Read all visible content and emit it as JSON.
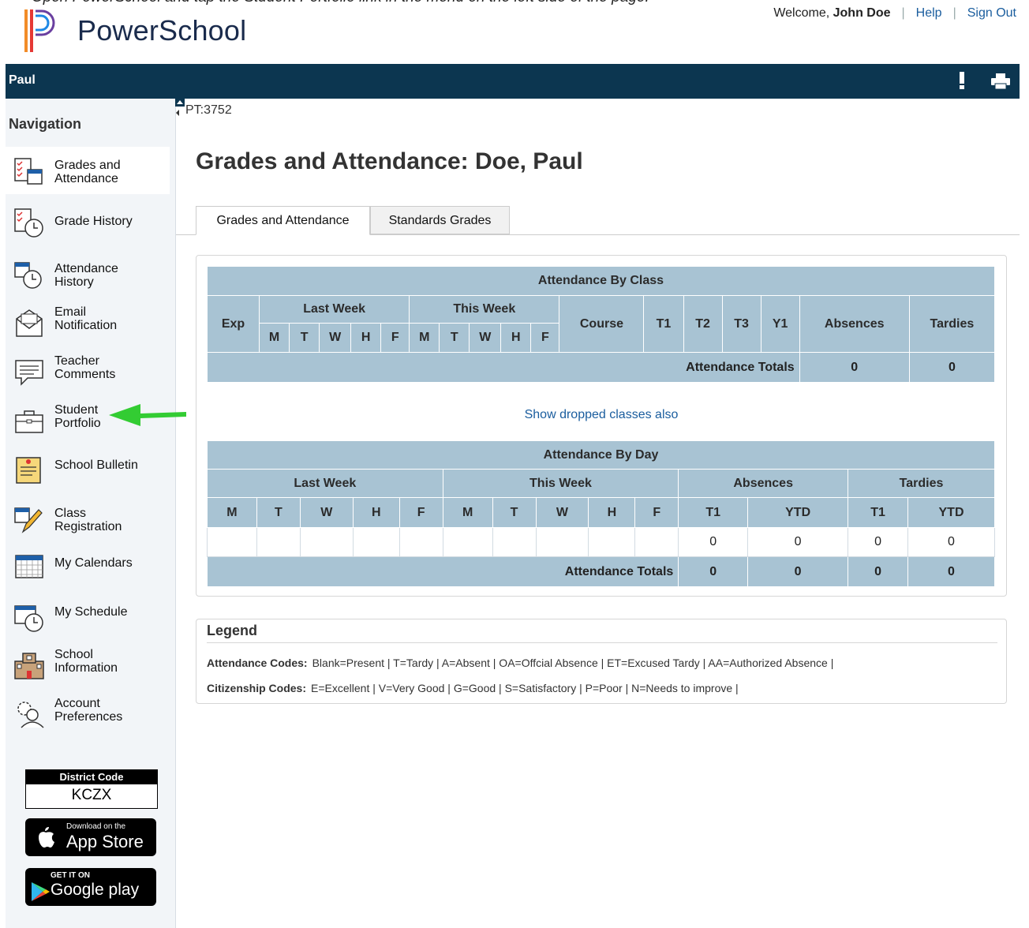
{
  "header": {
    "cutoff_text": "Open PowerSchool and tap the Student Portfolio link in the menu on the left side of the page.",
    "app_name": "PowerSchool",
    "welcome_label": "Welcome,",
    "user_name": "John Doe",
    "help": "Help",
    "sign_out": "Sign Out"
  },
  "bar": {
    "student": "Paul"
  },
  "nav": {
    "title": "Navigation",
    "items": [
      {
        "line1": "Grades and",
        "line2": "Attendance"
      },
      {
        "line1": "Grade History",
        "line2": ""
      },
      {
        "line1": "Attendance",
        "line2": "History"
      },
      {
        "line1": "Email",
        "line2": "Notification"
      },
      {
        "line1": "Teacher",
        "line2": "Comments"
      },
      {
        "line1": "Student",
        "line2": "Portfolio"
      },
      {
        "line1": "School Bulletin",
        "line2": ""
      },
      {
        "line1": "Class",
        "line2": "Registration"
      },
      {
        "line1": "My Calendars",
        "line2": ""
      },
      {
        "line1": "My Schedule",
        "line2": ""
      },
      {
        "line1": "School",
        "line2": "Information"
      },
      {
        "line1": "Account",
        "line2": "Preferences"
      }
    ],
    "district": {
      "label": "District Code",
      "value": "KCZX"
    },
    "appstore": {
      "small": "Download on the",
      "big": "App Store"
    },
    "googleplay": {
      "small": "GET IT ON",
      "big": "Google play"
    }
  },
  "page": {
    "pt": "PT:3752",
    "title": "Grades and Attendance: Doe, Paul",
    "tabs": [
      "Grades and Attendance",
      "Standards Grades"
    ],
    "show_dropped": "Show dropped classes also"
  },
  "by_class": {
    "title": "Attendance By Class",
    "exp": "Exp",
    "last_week": "Last Week",
    "this_week": "This Week",
    "days": [
      "M",
      "T",
      "W",
      "H",
      "F"
    ],
    "course": "Course",
    "terms": [
      "T1",
      "T2",
      "T3",
      "Y1"
    ],
    "absences": "Absences",
    "tardies": "Tardies",
    "totals_label": "Attendance Totals",
    "total_absences": "0",
    "total_tardies": "0"
  },
  "by_day": {
    "title": "Attendance By Day",
    "last_week": "Last Week",
    "this_week": "This Week",
    "absences": "Absences",
    "tardies": "Tardies",
    "days": [
      "M",
      "T",
      "W",
      "H",
      "F"
    ],
    "sub": [
      "T1",
      "YTD"
    ],
    "row": [
      "0",
      "0",
      "0",
      "0"
    ],
    "totals_label": "Attendance Totals",
    "totals": [
      "0",
      "0",
      "0",
      "0"
    ]
  },
  "legend": {
    "title": "Legend",
    "attendance_label": "Attendance Codes:",
    "attendance": "Blank=Present | T=Tardy | A=Absent | OA=Offcial Absence | ET=Excused Tardy | AA=Authorized Absence |",
    "citizenship_label": "Citizenship Codes:",
    "citizenship": "E=Excellent | V=Very Good | G=Good | S=Satisfactory | P=Poor | N=Needs to improve |"
  },
  "colors": {
    "bar": "#0c3650",
    "table_header": "#a8c3d3",
    "link": "#1a5d9e",
    "arrow": "#33cc33"
  }
}
